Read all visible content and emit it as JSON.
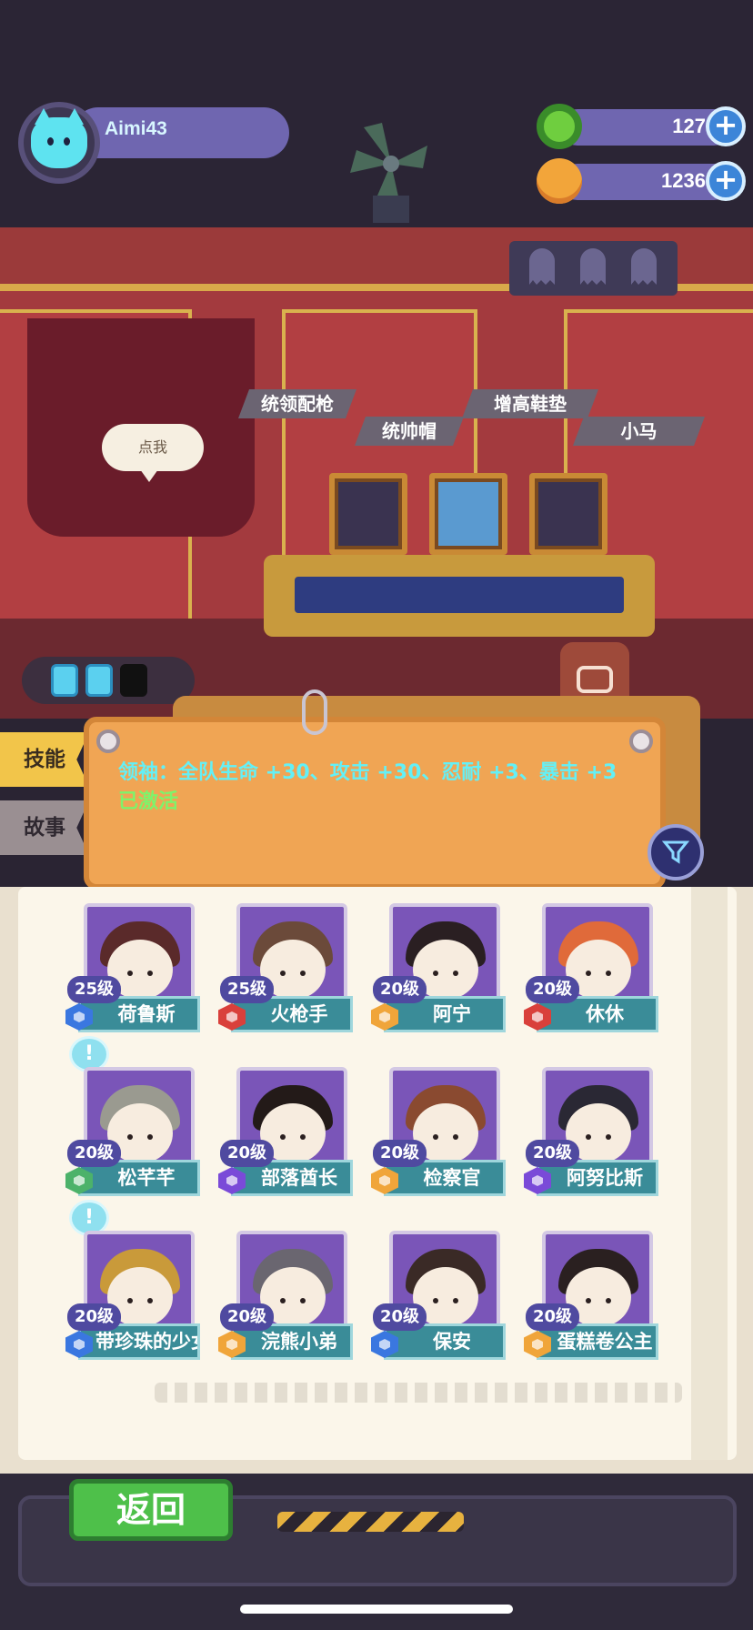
{
  "player": {
    "name": "Aimi43"
  },
  "currencies": [
    {
      "name": "donut",
      "icon": "donut-icon",
      "value": "127",
      "color": "#6fce3f"
    },
    {
      "name": "planet-coin",
      "icon": "planet-coin-icon",
      "value": "1236",
      "color": "#f2a53a"
    }
  ],
  "room": {
    "speech_bubble": "点我",
    "item_tags": [
      "统领配枪",
      "统帅帽",
      "增高鞋垫",
      "小马"
    ]
  },
  "energy": {
    "filled": 2,
    "total": 3
  },
  "side_tabs": [
    {
      "label": "技能",
      "active": true
    },
    {
      "label": "故事",
      "active": false
    }
  ],
  "skill": {
    "text": "领袖：全队生命 +30、攻击 +30、忍耐 +3、暴击 +3",
    "status": "已激活"
  },
  "characters": [
    {
      "level": "25级",
      "name": "荷鲁斯",
      "badge_color": "#3a77e0",
      "hair": "#5a2a2a",
      "alert": false
    },
    {
      "level": "25级",
      "name": "火枪手",
      "badge_color": "#d9403b",
      "hair": "#6b4a3a",
      "alert": false
    },
    {
      "level": "20级",
      "name": "阿宁",
      "badge_color": "#f0a53a",
      "hair": "#2a1f22",
      "alert": false
    },
    {
      "level": "20级",
      "name": "休休",
      "badge_color": "#d9403b",
      "hair": "#e06a3a",
      "alert": false
    },
    {
      "level": "20级",
      "name": "松芊芊",
      "badge_color": "#4cb26a",
      "hair": "#9a9a90",
      "alert": true
    },
    {
      "level": "20级",
      "name": "部落酋长",
      "badge_color": "#7a4ad8",
      "hair": "#231a18",
      "alert": false
    },
    {
      "level": "20级",
      "name": "检察官",
      "badge_color": "#f0a53a",
      "hair": "#8a4a30",
      "alert": false
    },
    {
      "level": "20级",
      "name": "阿努比斯",
      "badge_color": "#7a4ad8",
      "hair": "#2a2834",
      "alert": false
    },
    {
      "level": "20级",
      "name": "带珍珠的少女",
      "badge_color": "#3a77e0",
      "hair": "#c99a3a",
      "alert": true
    },
    {
      "level": "20级",
      "name": "浣熊小弟",
      "badge_color": "#f0a53a",
      "hair": "#6a6670",
      "alert": false
    },
    {
      "level": "20级",
      "name": "保安",
      "badge_color": "#3a77e0",
      "hair": "#3a2a26",
      "alert": false
    },
    {
      "level": "20级",
      "name": "蛋糕卷公主",
      "badge_color": "#f0a53a",
      "hair": "#2a2020",
      "alert": false
    }
  ],
  "back_button": "返回"
}
